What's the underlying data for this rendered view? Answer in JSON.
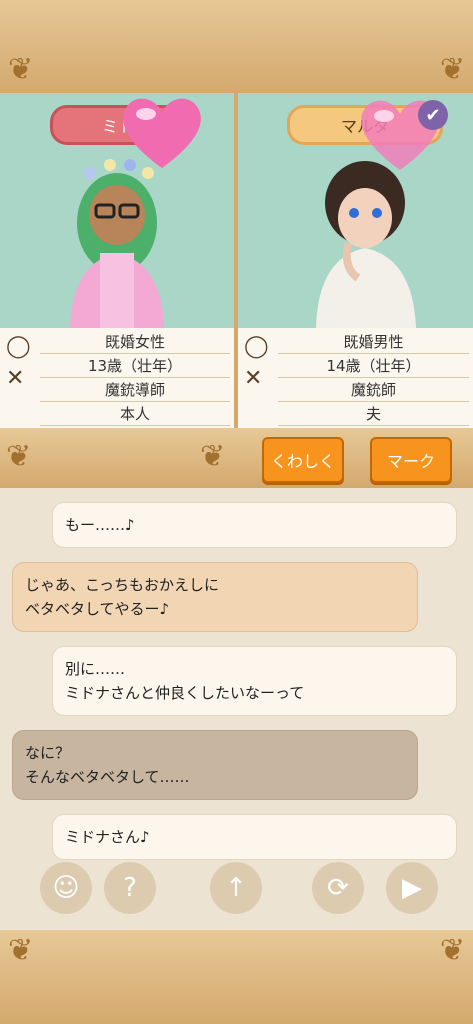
{
  "left_character": {
    "name": "ミト",
    "marital": "既婚女性",
    "age": "13歳（壮年）",
    "job": "魔銃導師",
    "relation": "本人"
  },
  "right_character": {
    "name": "マルタ",
    "marital": "既婚男性",
    "age": "14歳（壮年）",
    "job": "魔銃師",
    "relation": "夫"
  },
  "buttons": {
    "detail": "くわしく",
    "mark": "マーク"
  },
  "messages": [
    {
      "side": "right",
      "text": "もー……♪"
    },
    {
      "side": "left",
      "text": "じゃあ、こっちもおかえしに\nベタベタしてやるー♪"
    },
    {
      "side": "right",
      "text": "別に……\nミドナさんと仲良くしたいなーって"
    },
    {
      "side": "left",
      "text": "なに？\nそんなベタベタして……"
    },
    {
      "side": "right",
      "text": "ミドナさん♪"
    }
  ],
  "icons": {
    "ring": "ring-icon",
    "tools": "crossed-tools-icon",
    "check": "check-icon",
    "heart": "heart-icon"
  }
}
